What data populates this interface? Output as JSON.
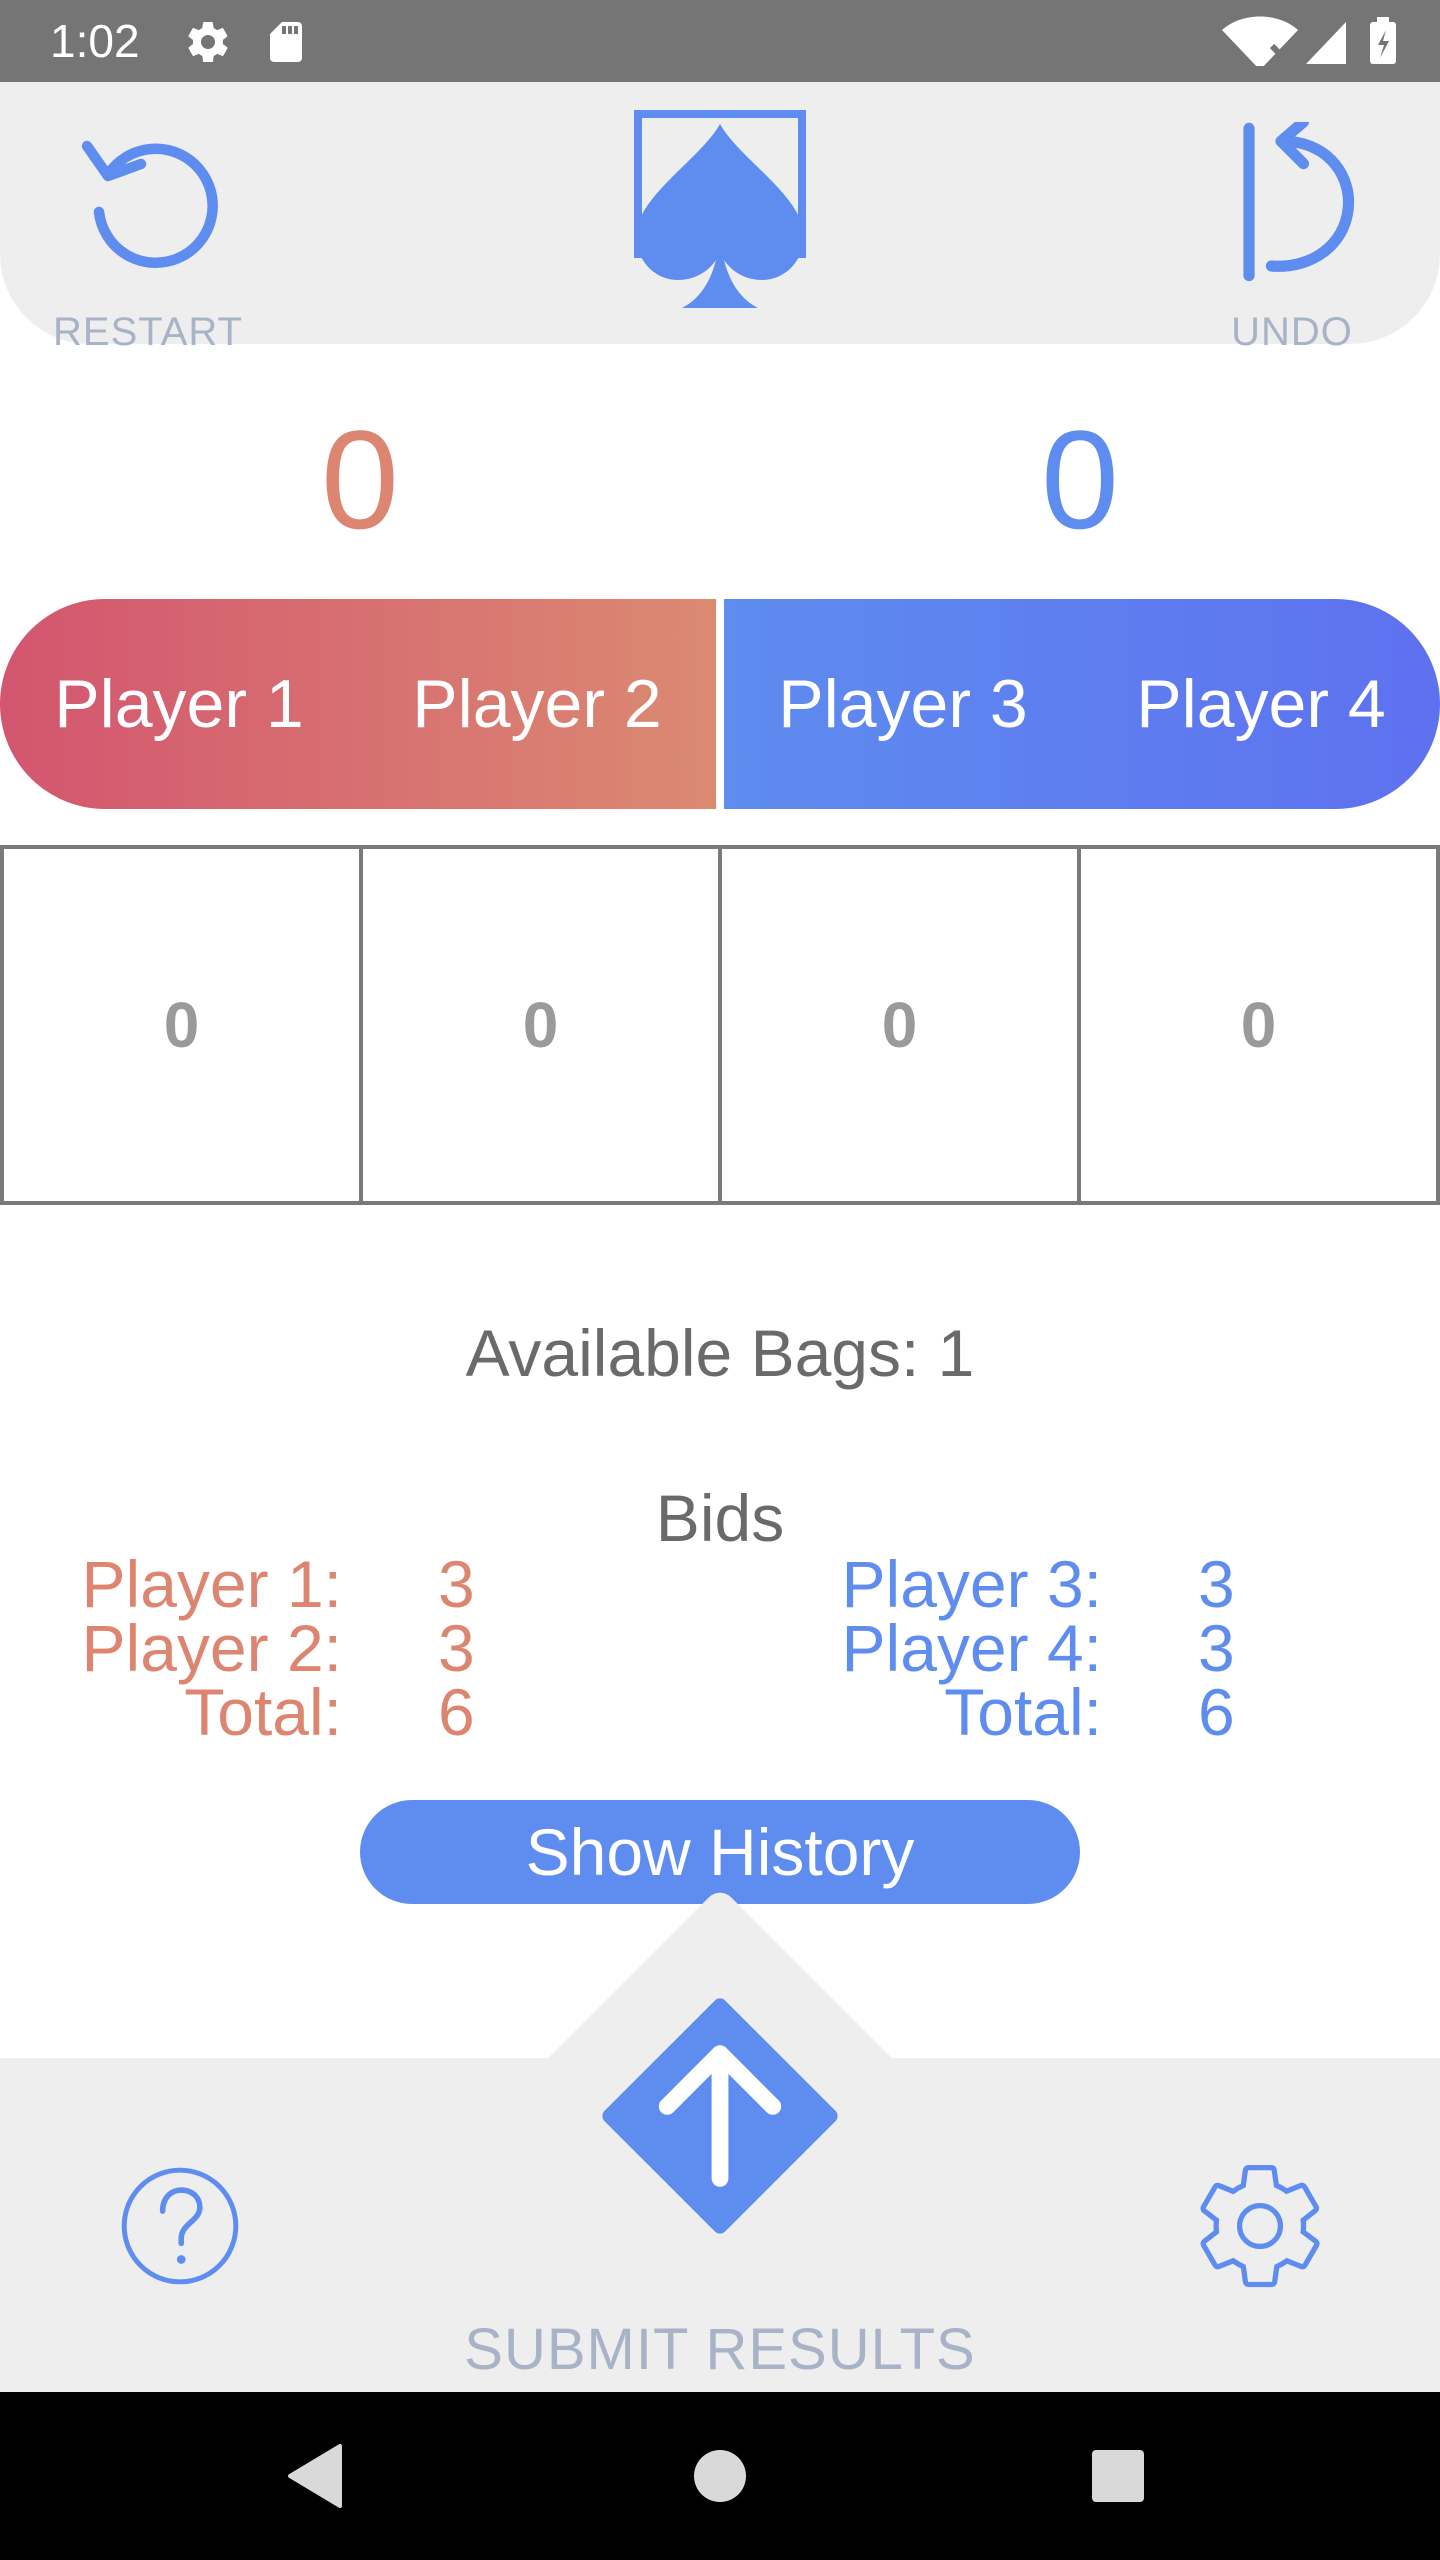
{
  "status_bar": {
    "time": "1:02",
    "left_icons": [
      "settings-icon",
      "sd-card-icon"
    ],
    "right_icons": [
      "wifi-icon",
      "signal-icon",
      "battery-charging-icon"
    ]
  },
  "top_bar": {
    "restart_label": "RESTART",
    "undo_label": "UNDO",
    "logo_icon": "spade-card-icon"
  },
  "scores": {
    "team_red": "0",
    "team_blue": "0"
  },
  "players": [
    "Player 1",
    "Player 2",
    "Player 3",
    "Player 4"
  ],
  "tricks": [
    "0",
    "0",
    "0",
    "0"
  ],
  "bags_text": "Available Bags: 1",
  "bids": {
    "title": "Bids",
    "team_red": {
      "rows": [
        {
          "label": "Player 1:",
          "value": "3"
        },
        {
          "label": "Player 2:",
          "value": "3"
        },
        {
          "label": "Total:",
          "value": "6"
        }
      ]
    },
    "team_blue": {
      "rows": [
        {
          "label": "Player 3:",
          "value": "3"
        },
        {
          "label": "Player 4:",
          "value": "3"
        },
        {
          "label": "Total:",
          "value": "6"
        }
      ]
    }
  },
  "history_button": "Show History",
  "bottom_bar": {
    "submit_label": "SUBMIT RESULTS",
    "help_icon": "help-icon",
    "settings_icon": "gear-icon"
  },
  "colors": {
    "accent_blue": "#5e8def",
    "accent_red": "#dc8671",
    "label_gray": "#a9b3c8"
  }
}
